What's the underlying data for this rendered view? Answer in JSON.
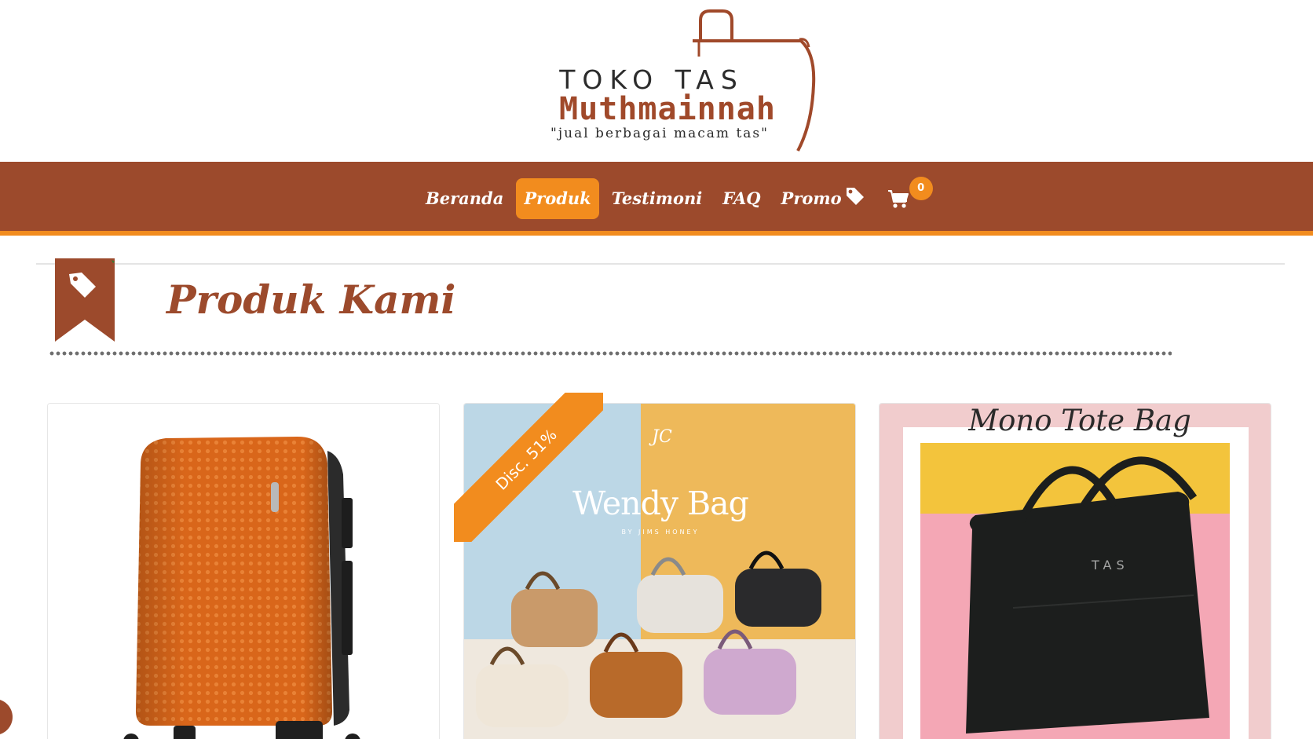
{
  "logo": {
    "line1": "TOKO TAS",
    "line2": "Muthmainnah",
    "tagline": "\"jual berbagai macam tas\""
  },
  "nav": {
    "items": [
      {
        "label": "Beranda",
        "active": false
      },
      {
        "label": "Produk",
        "active": true
      },
      {
        "label": "Testimoni",
        "active": false
      },
      {
        "label": "FAQ",
        "active": false
      },
      {
        "label": "Promo",
        "active": false
      }
    ],
    "cart_count": "0"
  },
  "section": {
    "title": "Produk Kami",
    "icon": "tag-icon"
  },
  "products": [
    {
      "name": "orange-suitcase",
      "image_icon": "suitcase-image"
    },
    {
      "name": "wendy-bag",
      "image_title": "Wendy Bag",
      "image_subtitle": "BY JIMS HONEY",
      "image_monogram": "JC",
      "discount": "Disc. 51%"
    },
    {
      "name": "mono-tote-bag",
      "image_title": "Mono Tote Bag",
      "image_watermark": "TAS"
    }
  ],
  "colors": {
    "brand_brown": "#9c4a2c",
    "accent_orange": "#f28c1e",
    "white": "#ffffff"
  }
}
